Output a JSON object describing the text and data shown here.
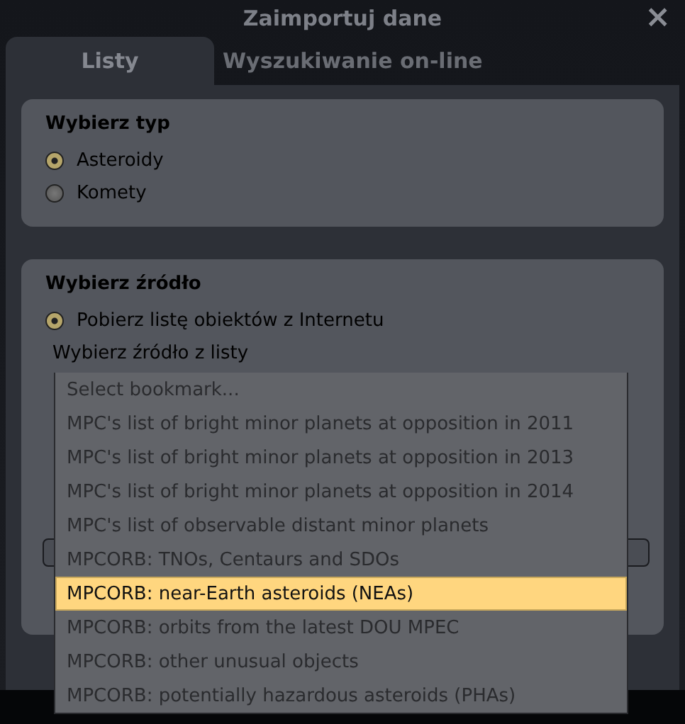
{
  "window": {
    "title": "Zaimportuj dane",
    "close": "×"
  },
  "tabs": [
    {
      "label": "Listy",
      "selected": true
    },
    {
      "label": "Wyszukiwanie on-line",
      "selected": false
    }
  ],
  "type_group": {
    "title": "Wybierz typ",
    "options": [
      {
        "label": "Asteroidy",
        "selected": true
      },
      {
        "label": "Komety",
        "selected": false
      }
    ]
  },
  "source_group": {
    "title": "Wybierz źródło",
    "option": {
      "label": "Pobierz listę obiektów z Internetu",
      "selected": true
    },
    "list_label": "Wybierz źródło z listy",
    "dropdown_items": [
      {
        "label": "Select bookmark...",
        "selected": false
      },
      {
        "label": "MPC's list of bright minor planets at opposition in 2011",
        "selected": false
      },
      {
        "label": "MPC's list of bright minor planets at opposition in 2013",
        "selected": false
      },
      {
        "label": "MPC's list of bright minor planets at opposition in 2014",
        "selected": false
      },
      {
        "label": "MPC's list of observable distant minor planets",
        "selected": false
      },
      {
        "label": "MPCORB: TNOs, Centaurs and SDOs",
        "selected": false
      },
      {
        "label": "MPCORB: near-Earth asteroids (NEAs)",
        "selected": true
      },
      {
        "label": "MPCORB: orbits from the latest DOU MPEC",
        "selected": false
      },
      {
        "label": "MPCORB: other unusual objects",
        "selected": false
      },
      {
        "label": "MPCORB: potentially hazardous asteroids (PHAs)",
        "selected": false
      }
    ]
  }
}
